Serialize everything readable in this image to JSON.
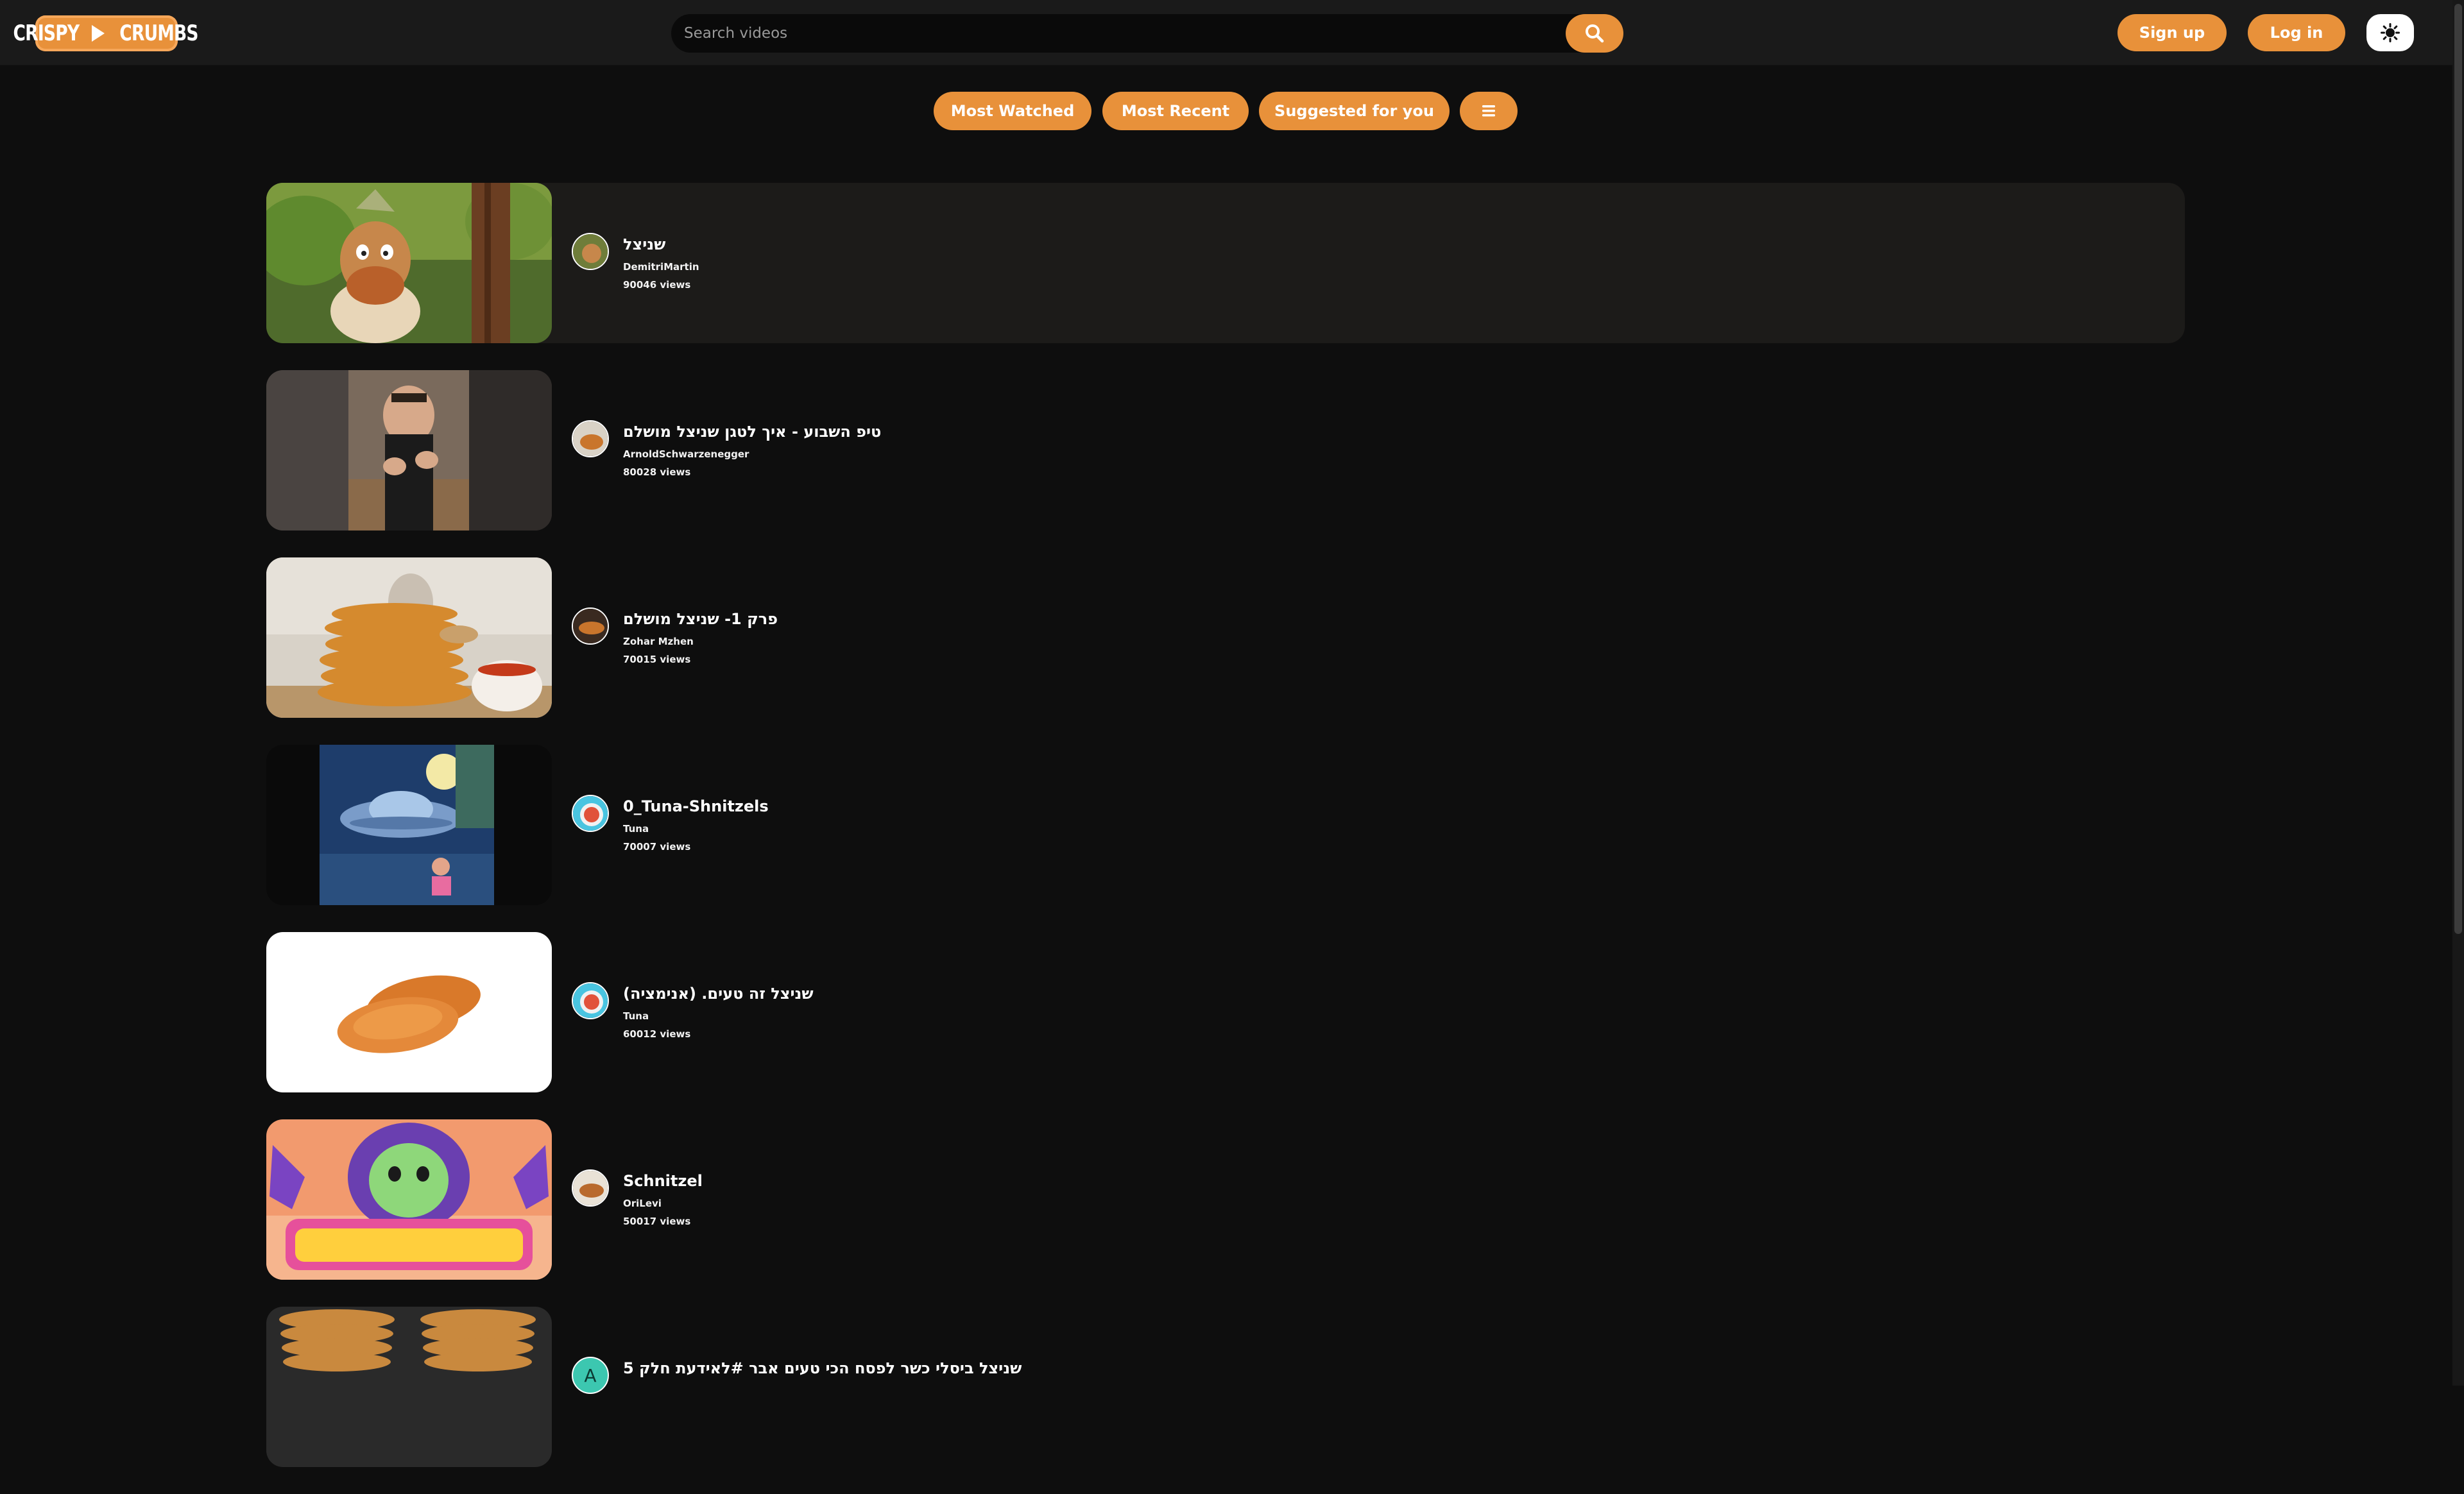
{
  "header": {
    "logo_left": "CRISPY",
    "logo_right": "CRUMBS",
    "search_placeholder": "Search videos",
    "signup_label": "Sign up",
    "login_label": "Log in",
    "accent_color": "#e8913a"
  },
  "filters": [
    {
      "label": "Most Watched"
    },
    {
      "label": "Most Recent"
    },
    {
      "label": "Suggested for you"
    },
    {
      "icon": "menu-icon"
    }
  ],
  "videos": [
    {
      "title": "שניצל",
      "author": "DemitriMartin",
      "views": "90046 views",
      "thumb": "cartoon-character",
      "active": true
    },
    {
      "title": "טיפ השבוע - איך לטגן שניצל מושלם",
      "author": "ArnoldSchwarzenegger",
      "views": "80028 views",
      "thumb": "chef-vertical-video"
    },
    {
      "title": "פרק 1- שניצל מושלם",
      "author": "Zohar Mzhen",
      "views": "70015 views",
      "thumb": "schnitzel-stack"
    },
    {
      "title": "0_Tuna-Shnitzels",
      "author": "Tuna",
      "views": "70007 views",
      "thumb": "ufo-cartoon-poster"
    },
    {
      "title": "שניצל זה טעים. (אנימציה)",
      "author": "Tuna",
      "views": "60012 views",
      "thumb": "two-schnitzels-white"
    },
    {
      "title": "Schnitzel",
      "author": "OriLevi",
      "views": "50017 views",
      "thumb": "schnitzel-cartoon-logo"
    },
    {
      "title": "שניצל ביסלי כשר לפסח הכי טעים אבר #לאידעת חלק 5",
      "author": "",
      "views": "",
      "thumb": "schnitzel-plates",
      "avatar_letter": "A"
    }
  ]
}
